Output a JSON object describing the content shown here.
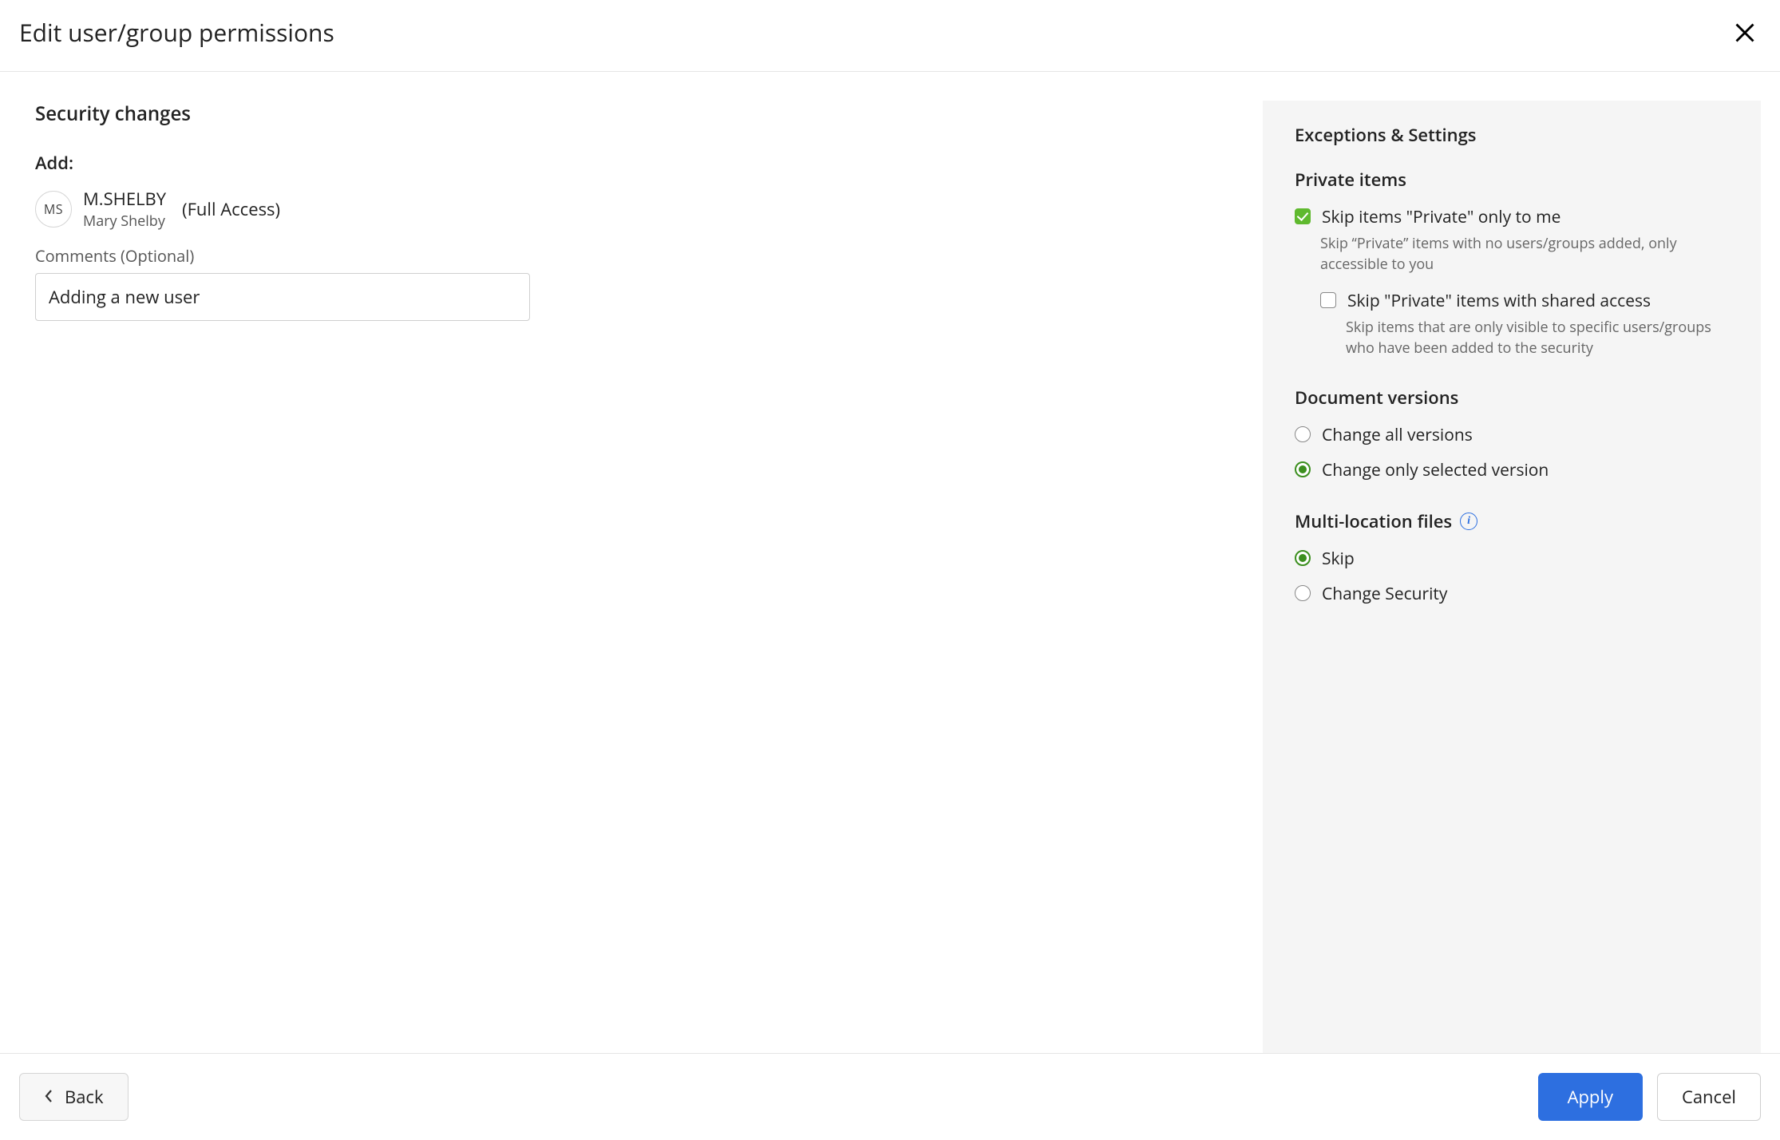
{
  "dialog": {
    "title": "Edit user/group permissions"
  },
  "security": {
    "heading": "Security changes",
    "add_label": "Add:",
    "user": {
      "initials": "MS",
      "id": "M.SHELBY",
      "name": "Mary Shelby",
      "access": "(Full Access)"
    },
    "comments_label": "Comments (Optional)",
    "comments_value": "Adding a new user"
  },
  "exceptions": {
    "heading": "Exceptions & Settings",
    "private": {
      "heading": "Private items",
      "skip_me": {
        "label": "Skip items \"Private\" only to me",
        "desc": "Skip “Private” items with no users/groups added, only accessible to you",
        "checked": true
      },
      "skip_shared": {
        "label": "Skip \"Private\" items with shared access",
        "desc": "Skip items that are only visible to specific users/groups who have been added to the security",
        "checked": false
      }
    },
    "versions": {
      "heading": "Document versions",
      "all": {
        "label": "Change all versions",
        "selected": false
      },
      "sel": {
        "label": "Change only selected version",
        "selected": true
      }
    },
    "multiloc": {
      "heading": "Multi-location files",
      "skip": {
        "label": "Skip",
        "selected": true
      },
      "change": {
        "label": "Change Security",
        "selected": false
      }
    }
  },
  "footer": {
    "back": "Back",
    "apply": "Apply",
    "cancel": "Cancel"
  }
}
